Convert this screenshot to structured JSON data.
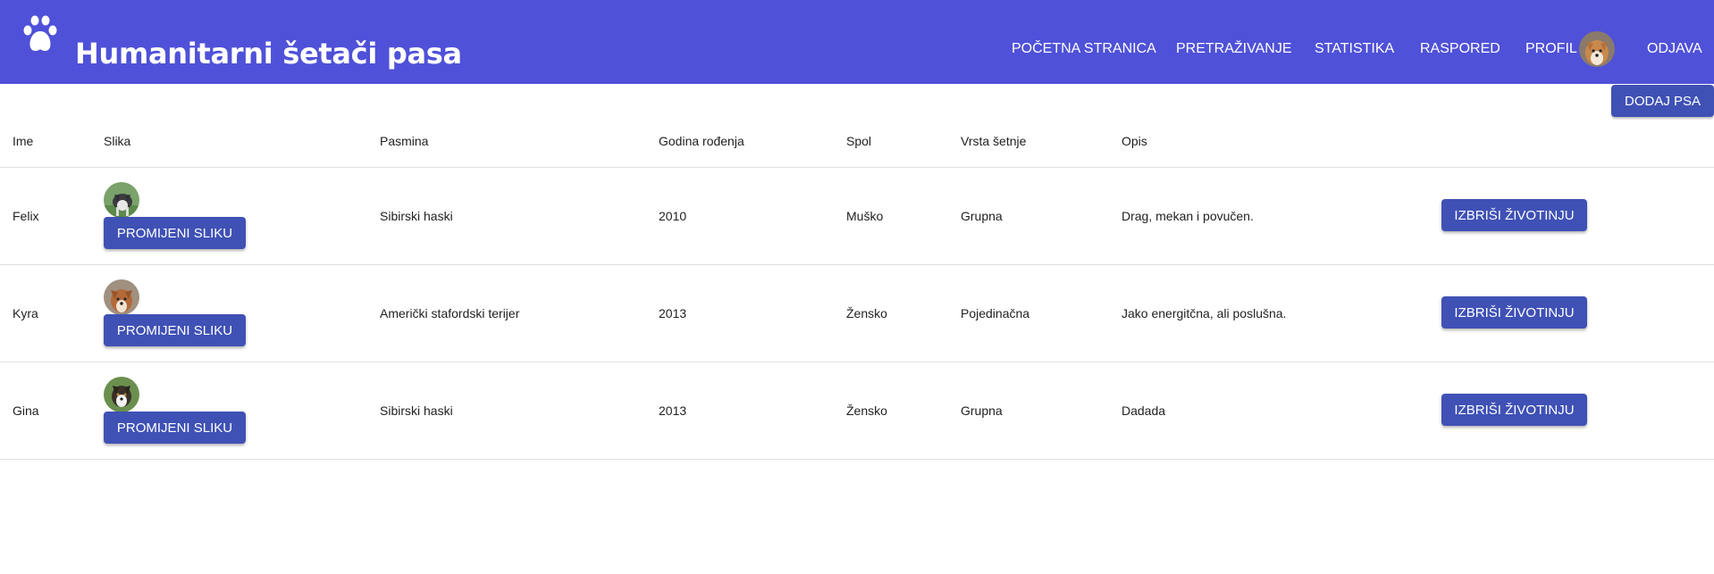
{
  "app": {
    "title": "Humanitarni šetači pasa",
    "logo_icon": "paw-icon",
    "bar_color": "#4f51d8"
  },
  "nav": {
    "home": "POČETNA STRANICA",
    "search": "PRETRAŽIVANJE",
    "stats": "STATISTIKA",
    "schedule": "RASPORED",
    "profile": "PROFIL",
    "logout": "ODJAVA"
  },
  "toolbar": {
    "add_label": "DODAJ PSA"
  },
  "table": {
    "headers": [
      "Ime",
      "Slika",
      "Pasmina",
      "Godina rođenja",
      "Spol",
      "Vrsta šetnje",
      "Opis"
    ],
    "change_label": "PROMIJENI SLIKU",
    "delete_label": "IZBRIŠI ŽIVOTINJU",
    "rows": [
      {
        "name": "Felix",
        "breed": "Sibirski haski",
        "year": "2010",
        "sex": "Muško",
        "walk": "Grupna",
        "desc": "Drag, mekan i povučen."
      },
      {
        "name": "Kyra",
        "breed": "Američki stafordski terijer",
        "year": "2013",
        "sex": "Žensko",
        "walk": "Pojedinačna",
        "desc": "Jako energitčna, ali poslušna."
      },
      {
        "name": "Gina",
        "breed": "Sibirski haski",
        "year": "2013",
        "sex": "Žensko",
        "walk": "Grupna",
        "desc": "Dadada"
      }
    ]
  }
}
